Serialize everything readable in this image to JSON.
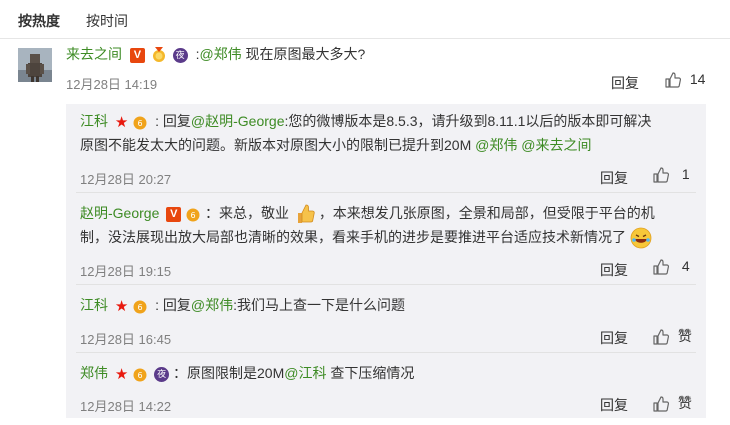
{
  "sort": {
    "hot": "按热度",
    "time": "按时间"
  },
  "main_comment": {
    "username": "来去之间",
    "mention": "@郑伟",
    "text": " 现在原图最大多大?",
    "time": "12月28日 14:19",
    "reply_label": "回复",
    "likes": "14"
  },
  "replies": [
    {
      "username": "江科",
      "reply_prefix": "回复",
      "reply_to": "@赵明-George",
      "text_line1": ":您的微博版本是8.5.3，请升级到8.11.1以后的版本即可解决",
      "text_line2a": "原图不能发太大的问题。新版本对原图大小的限制已提升到20M ",
      "mention1": "@郑伟",
      "mention2": "@来去之间",
      "time": "12月28日 20:27",
      "reply_label": "回复",
      "likes": "1"
    },
    {
      "username": "赵明-George",
      "text_line1a": "：来总，敬业",
      "text_line1b": "，本来想发几张原图，全景和局部，但受限于平台的机",
      "text_line2": "制，没法展现出放大局部也清晰的效果，看来手机的进步是要推进平台适应技术新情况了",
      "time": "12月28日 19:15",
      "reply_label": "回复",
      "likes": "4"
    },
    {
      "username": "江科",
      "reply_prefix": "回复",
      "reply_to": "@郑伟",
      "text": ":我们马上查一下是什么问题",
      "time": "12月28日 16:45",
      "reply_label": "回复",
      "like_label": "赞"
    },
    {
      "username": "郑伟",
      "text_a": "：原图限制是20M",
      "mention": "@江科",
      "text_b": " 查下压缩情况",
      "time": "12月28日 14:22",
      "reply_label": "回复",
      "like_label": "赞"
    }
  ],
  "badges": {
    "vip": "V",
    "night": "夜"
  },
  "colors": {
    "link": "#3d8b24",
    "reply_bg": "#f2f2f5",
    "time": "#808080",
    "vip": "#e8470e"
  },
  "icons": [
    "thumb-up-icon",
    "star-badge-icon",
    "vip-badge-icon",
    "medal-icon",
    "night-badge-icon",
    "level-badge-icon",
    "thumbs-up-emoji-icon",
    "laughing-emoji-icon"
  ]
}
